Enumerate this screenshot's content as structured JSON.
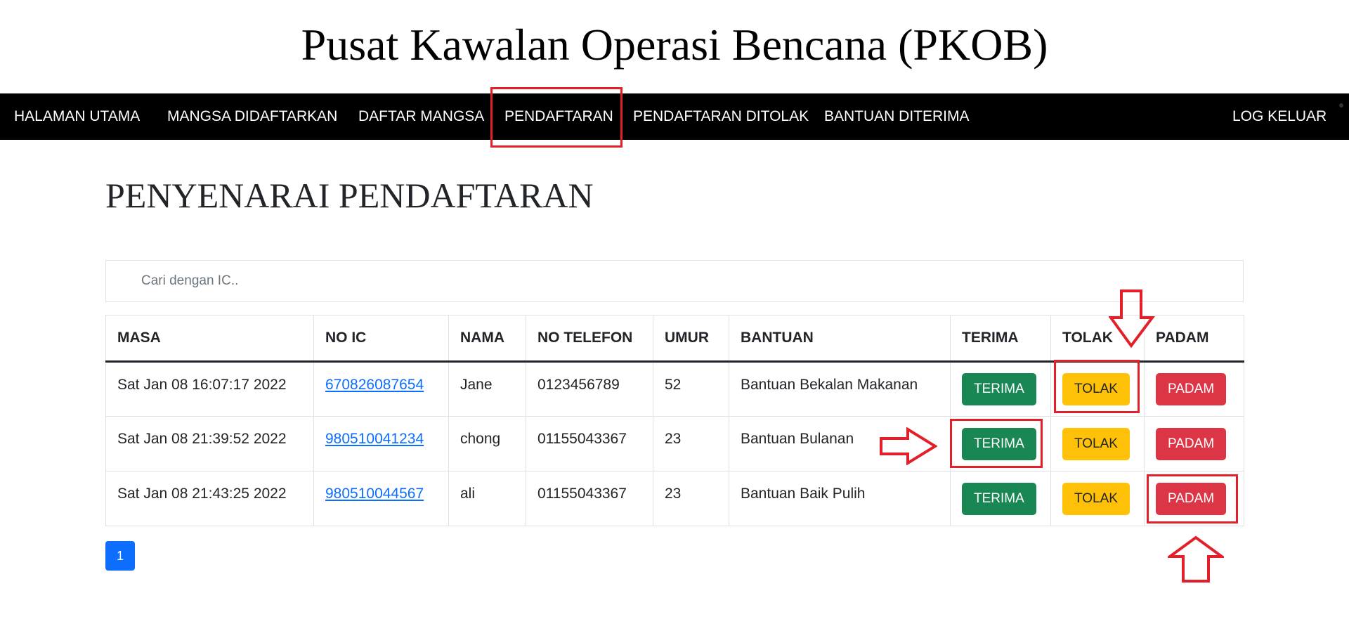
{
  "header": {
    "title": "Pusat Kawalan Operasi Bencana (PKOB)"
  },
  "nav": {
    "items": [
      {
        "label": "HALAMAN UTAMA"
      },
      {
        "label": "MANGSA DIDAFTARKAN"
      },
      {
        "label": "DAFTAR MANGSA"
      },
      {
        "label": "PENDAFTARAN"
      },
      {
        "label": "PENDAFTARAN DITOLAK"
      },
      {
        "label": "BANTUAN DITERIMA"
      }
    ],
    "logout_label": "LOG KELUAR",
    "active": "PENDAFTARAN"
  },
  "main": {
    "heading": "PENYENARAI PENDAFTARAN",
    "search": {
      "placeholder": "Cari dengan IC..",
      "value": ""
    },
    "table": {
      "headers": [
        "MASA",
        "NO IC",
        "NAMA",
        "NO TELEFON",
        "UMUR",
        "BANTUAN",
        "TERIMA",
        "TOLAK",
        "PADAM"
      ],
      "rows": [
        {
          "masa": "Sat Jan 08 16:07:17 2022",
          "ic": "670826087654",
          "nama": "Jane",
          "telefon": "0123456789",
          "umur": "52",
          "bantuan": "Bantuan Bekalan Makanan"
        },
        {
          "masa": "Sat Jan 08 21:39:52 2022",
          "ic": "980510041234",
          "nama": "chong",
          "telefon": "01155043367",
          "umur": "23",
          "bantuan": "Bantuan Bulanan"
        },
        {
          "masa": "Sat Jan 08 21:43:25 2022",
          "ic": "980510044567",
          "nama": "ali",
          "telefon": "01155043367",
          "umur": "23",
          "bantuan": "Bantuan Baik Pulih"
        }
      ],
      "buttons": {
        "terima": "TERIMA",
        "tolak": "TOLAK",
        "padam": "PADAM"
      }
    },
    "pagination": {
      "current": "1"
    }
  },
  "colors": {
    "navbar": "#000000",
    "link": "#0d6efd",
    "terima": "#198754",
    "tolak": "#ffc107",
    "padam": "#dc3545",
    "annotation": "#e3202a"
  }
}
